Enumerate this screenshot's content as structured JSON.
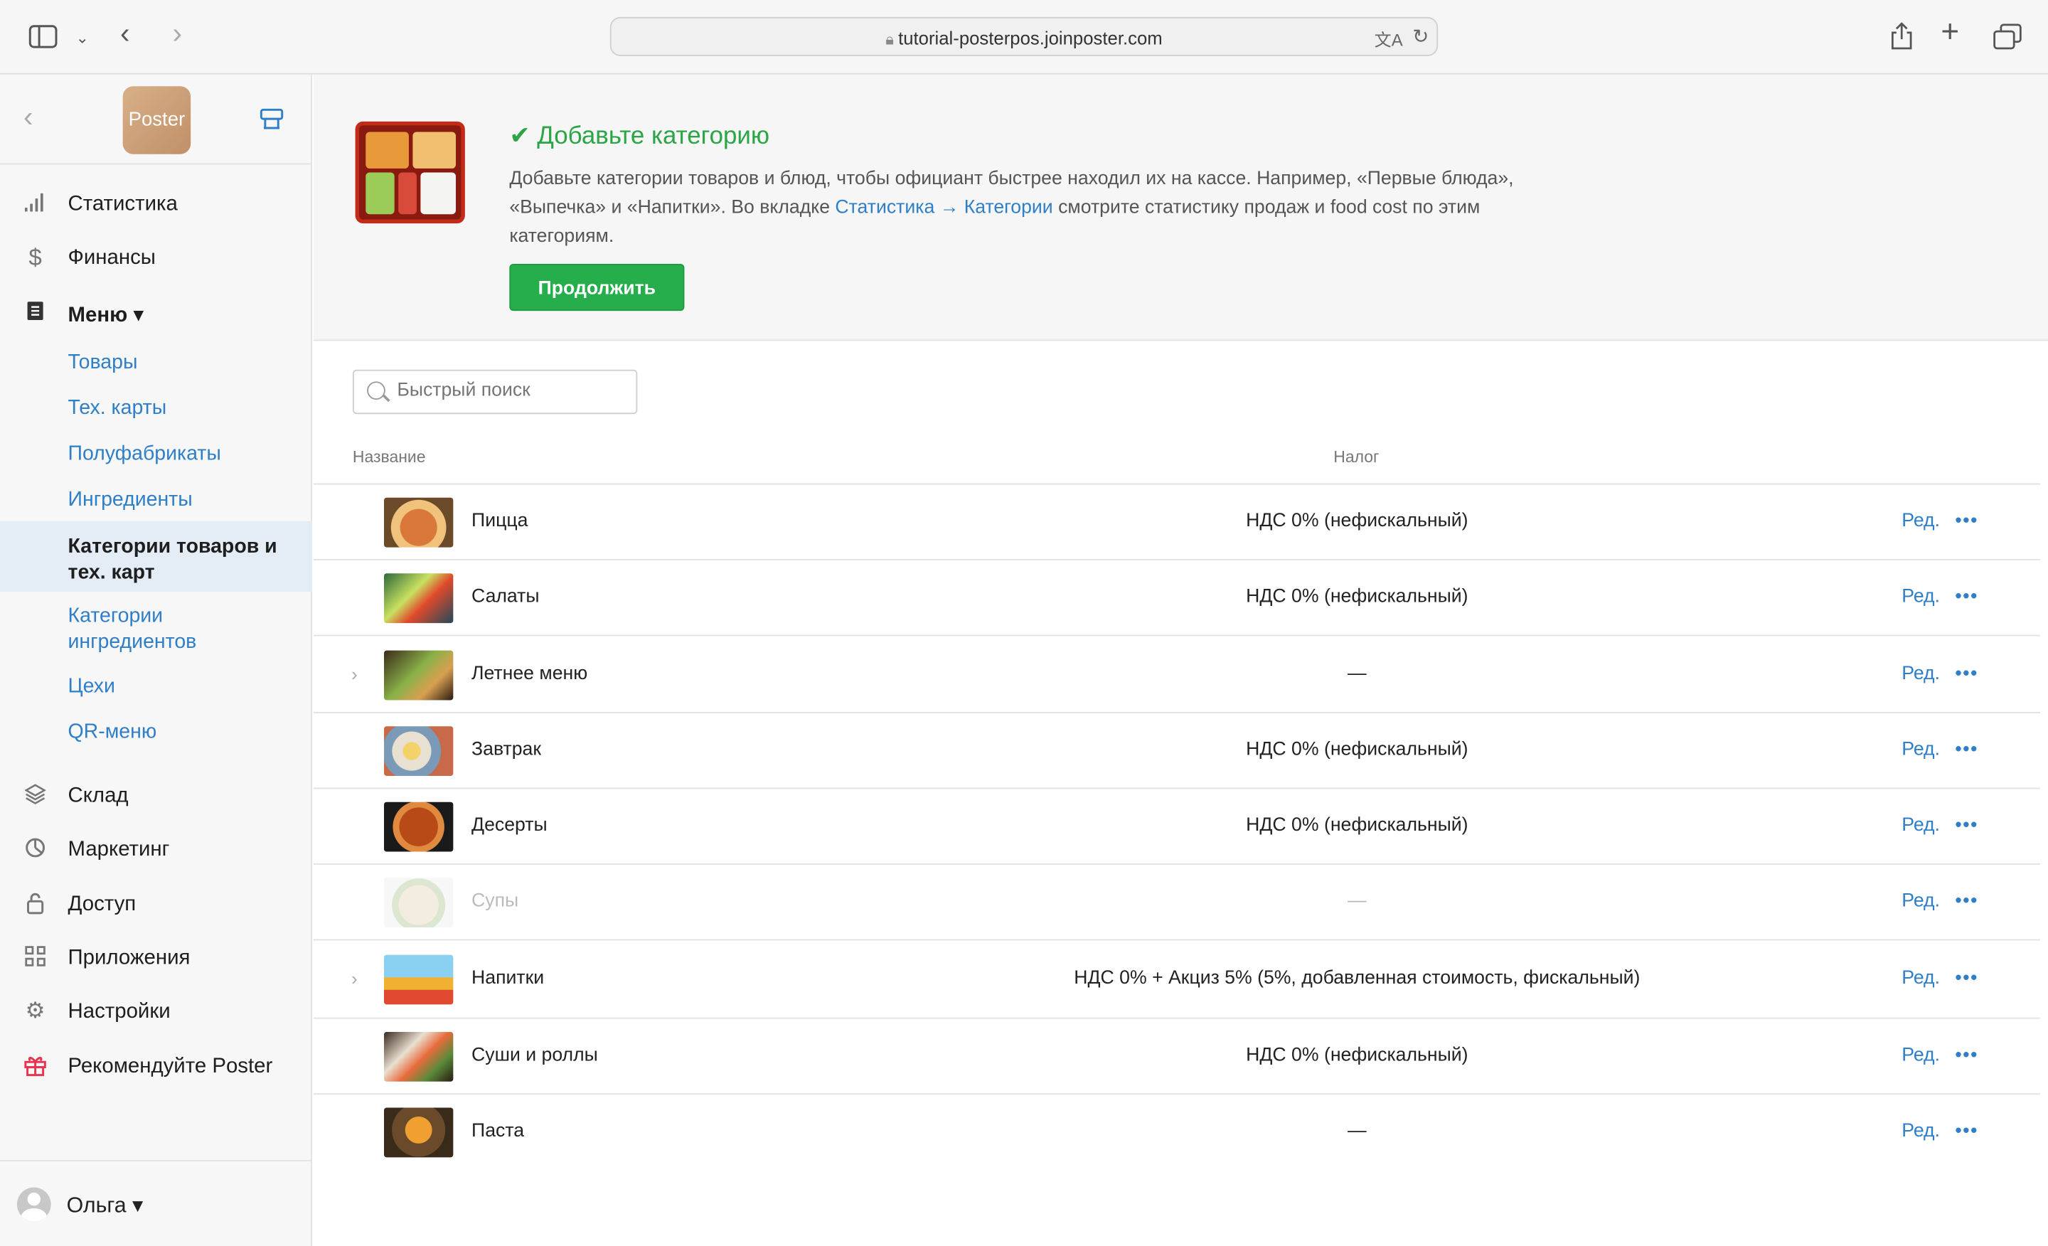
{
  "browser": {
    "url": "tutorial-posterpos.joinposter.com"
  },
  "sidebar": {
    "logo_text": "Poster",
    "main_items": [
      {
        "label": "Статистика",
        "icon": "bar-chart-icon"
      },
      {
        "label": "Финансы",
        "icon": "dollar-icon"
      },
      {
        "label": "Меню ▾",
        "icon": "document-icon"
      }
    ],
    "sub_items": [
      "Товары",
      "Тех. карты",
      "Полуфабрикаты",
      "Ингредиенты"
    ],
    "active_item": "Категории товаров и тех. карт",
    "sub_items_after": [
      "Категории ингредиентов",
      "Цехи",
      "QR-меню"
    ],
    "bottom_items": [
      {
        "label": "Склад",
        "icon": "layers-icon"
      },
      {
        "label": "Маркетинг",
        "icon": "pie-chart-icon"
      },
      {
        "label": "Доступ",
        "icon": "lock-icon"
      },
      {
        "label": "Приложения",
        "icon": "grid-icon"
      },
      {
        "label": "Настройки",
        "icon": "gear-icon"
      },
      {
        "label": "Рекомендуйте Poster",
        "icon": "gift-icon"
      }
    ],
    "user": "Ольга ▾"
  },
  "banner": {
    "title": "✔ Добавьте категорию",
    "text_1": "Добавьте категории товаров и блюд, чтобы официант быстрее находил их на кассе. Например, «Первые блюда», «Выпечка» и «Напитки». Во вкладке ",
    "link_1": "Статистика → Категории",
    "text_2": " смотрите статистику продаж и food cost по этим категориям.",
    "button": "Продолжить"
  },
  "search": {
    "placeholder": "Быстрый поиск"
  },
  "table": {
    "columns": [
      "Название",
      "Налог"
    ],
    "edit_label": "Ред.",
    "more_label": "•••",
    "rows": [
      {
        "name": "Пицца",
        "tax": "НДС 0% (нефискальный)",
        "expand": false,
        "dim": false
      },
      {
        "name": "Салаты",
        "tax": "НДС 0% (нефискальный)",
        "expand": false,
        "dim": false
      },
      {
        "name": "Летнее меню",
        "tax": "—",
        "expand": true,
        "dim": false
      },
      {
        "name": "Завтрак",
        "tax": "НДС 0% (нефискальный)",
        "expand": false,
        "dim": false
      },
      {
        "name": "Десерты",
        "tax": "НДС 0% (нефискальный)",
        "expand": false,
        "dim": false
      },
      {
        "name": "Супы",
        "tax": "—",
        "expand": false,
        "dim": true
      },
      {
        "name": "Напитки",
        "tax": "НДС 0% + Акциз 5% (5%, добавленная стоимость, фискальный)",
        "expand": true,
        "dim": false
      },
      {
        "name": "Суши и роллы",
        "tax": "НДС 0% (нефискальный)",
        "expand": false,
        "dim": false
      },
      {
        "name": "Паста",
        "tax": "—",
        "expand": false,
        "dim": false
      }
    ]
  }
}
